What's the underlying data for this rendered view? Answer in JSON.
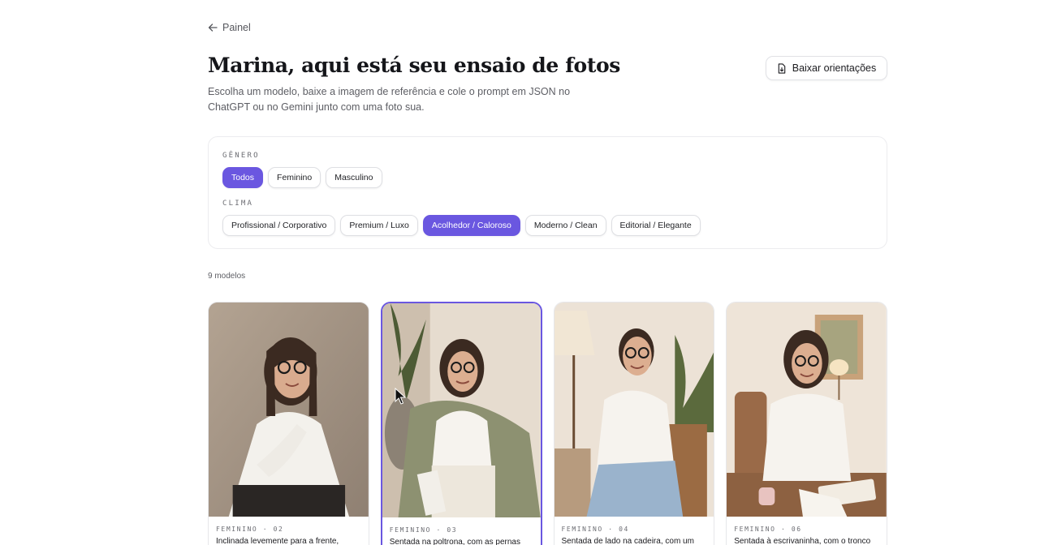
{
  "nav": {
    "back_label": "Painel"
  },
  "header": {
    "title": "Marina, aqui está seu ensaio de fotos",
    "subtitle": "Escolha um modelo, baixe a imagem de referência e cole o prompt em JSON no ChatGPT ou no Gemini junto com uma foto sua.",
    "download_label": "Baixar orientações"
  },
  "filters": {
    "gender_label": "GÊNERO",
    "gender_options": [
      {
        "label": "Todos",
        "active": true
      },
      {
        "label": "Feminino",
        "active": false
      },
      {
        "label": "Masculino",
        "active": false
      }
    ],
    "mood_label": "CLIMA",
    "mood_options": [
      {
        "label": "Profissional / Corporativo",
        "active": false
      },
      {
        "label": "Premium / Luxo",
        "active": false
      },
      {
        "label": "Acolhedor / Caloroso",
        "active": true
      },
      {
        "label": "Moderno / Clean",
        "active": false
      },
      {
        "label": "Editorial / Elegante",
        "active": false
      }
    ]
  },
  "results": {
    "count_label": "9 modelos"
  },
  "cards": [
    {
      "tag": "FEMININO · 02",
      "description": "Inclinada levemente para a frente,",
      "selected": false,
      "image_icon": "woman-portrait-leaning"
    },
    {
      "tag": "FEMININO · 03",
      "description": "Sentada na poltrona, com as pernas",
      "selected": true,
      "image_icon": "woman-portrait-armchair"
    },
    {
      "tag": "FEMININO · 04",
      "description": "Sentada de lado na cadeira, com um",
      "selected": false,
      "image_icon": "woman-portrait-chair"
    },
    {
      "tag": "FEMININO · 06",
      "description": "Sentada à escrivaninha, com o tronco",
      "selected": false,
      "image_icon": "woman-portrait-desk"
    }
  ],
  "colors": {
    "accent": "#6a57e0",
    "border": "#e6e7ea",
    "text": "#1b1b1f",
    "muted": "#5d5e64"
  }
}
